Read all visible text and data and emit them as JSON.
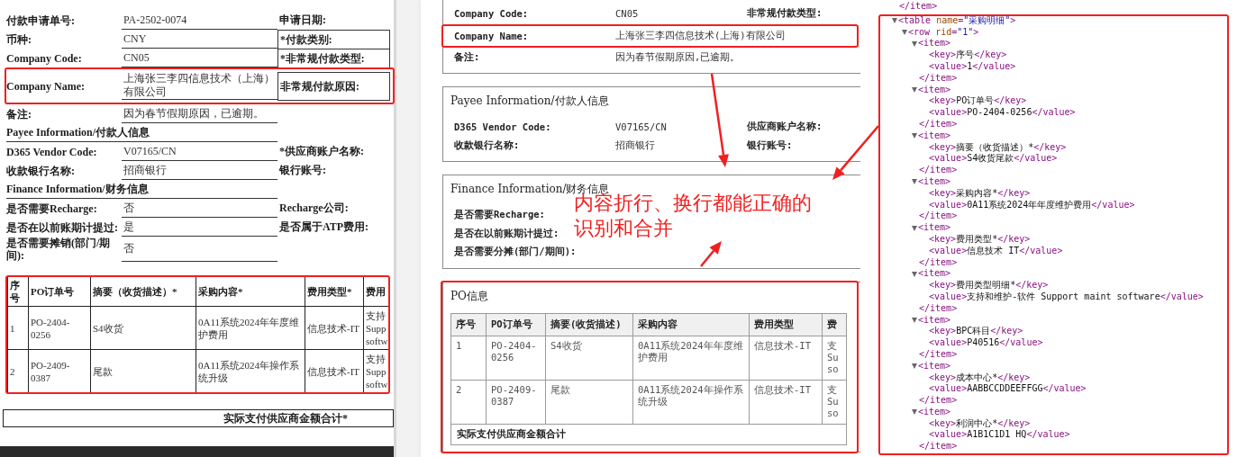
{
  "scan_form": {
    "rows": [
      {
        "kind": "field",
        "label": "付款申请单号:",
        "value": "PA-2502-0074",
        "side": "申请日期:",
        "side_boxed": false,
        "highlighted": false
      },
      {
        "kind": "field",
        "label": "币种:",
        "value": "CNY",
        "side": "*付款类别:",
        "side_boxed": true,
        "highlighted": false
      },
      {
        "kind": "field",
        "label": "Company Code:",
        "value": "CN05",
        "side": "*非常规付款类型:",
        "side_boxed": true,
        "highlighted": false
      },
      {
        "kind": "field",
        "label": "Company Name:",
        "value": "上海张三李四信息技术（上海）有限公司",
        "side": "非常规付款原因:",
        "side_boxed": true,
        "highlighted": true
      },
      {
        "kind": "field",
        "label": "备注:",
        "value": "因为春节假期原因，已逾期。",
        "highlighted": false
      },
      {
        "kind": "section",
        "label": "Payee Information/付款人信息",
        "highlighted": false
      },
      {
        "kind": "field",
        "label": "D365 Vendor Code:",
        "value": "V07165/CN",
        "side": "*供应商账户名称:",
        "side_boxed": false,
        "highlighted": false
      },
      {
        "kind": "field",
        "label": "收款银行名称:",
        "value": "招商银行",
        "side": "银行账号:",
        "side_boxed": false,
        "highlighted": false
      },
      {
        "kind": "section",
        "label": "Finance Information/财务信息",
        "highlighted": false
      },
      {
        "kind": "field",
        "label": "是否需要Recharge:",
        "value": "否",
        "side": "Recharge公司:",
        "side_boxed": false,
        "highlighted": false
      },
      {
        "kind": "field",
        "label": "是否在以前账期计提过:",
        "value": "是",
        "side": "是否属于ATP费用:",
        "side_boxed": false,
        "highlighted": false
      },
      {
        "kind": "field",
        "label": "是否需要摊销(部门/期间):",
        "value": "否",
        "highlighted": false
      }
    ],
    "table": {
      "highlighted": true,
      "columns": [
        "序号",
        "PO订单号",
        "摘要（收货描述）*",
        "采购内容*",
        "费用类型*",
        "费用"
      ],
      "rows": [
        [
          "1",
          "PO-2404-0256",
          "S4收货",
          "0A11系统2024年年度维护费用",
          "信息技术-IT",
          "支持\nSupp\nsoftw"
        ],
        [
          "2",
          "PO-2409-0387",
          "尾款",
          "0A11系统2024年操作系统升级",
          "信息技术-IT",
          "支持\nSupp\nsoftw"
        ]
      ]
    },
    "footer": "实际支付供应商金额合计*"
  },
  "rendered_form": {
    "cards": [
      {
        "highlighted": false,
        "rows": [
          {
            "label": "Company Code:",
            "value": "CN05",
            "side": "非常规付款类型:",
            "highlighted": false
          },
          {
            "label": "Company Name:",
            "value": "上海张三李四信息技术(上海)有限公司",
            "highlighted": true
          },
          {
            "label": "备注:",
            "value": "因为春节假期原因,已逾期。",
            "highlighted": false
          }
        ]
      },
      {
        "highlighted": false,
        "title": "Payee Information/付款人信息",
        "rows": [
          {
            "label": "D365 Vendor Code:",
            "value": "V07165/CN",
            "side": "供应商账户名称:",
            "highlighted": false
          },
          {
            "label": "收款银行名称:",
            "value": "招商银行",
            "side": "银行账号:",
            "highlighted": false
          }
        ]
      },
      {
        "highlighted": false,
        "title": "Finance Information/财务信息",
        "rows": [
          {
            "label": "是否需要Recharge:",
            "highlighted": false
          },
          {
            "label": "是否在以前账期计提过:",
            "highlighted": false
          },
          {
            "label": "是否需要分摊(部门/期间):",
            "highlighted": false
          }
        ]
      },
      {
        "highlighted": true,
        "title": "PO信息",
        "table": {
          "columns": [
            "序号",
            "PO订单号",
            "摘要(收货描述)",
            "采购内容",
            "费用类型",
            "费"
          ],
          "rows": [
            [
              "1",
              "PO-2404-0256",
              "S4收货",
              "0A11系统2024年年度维护费用",
              "信息技术-IT",
              "支\nSu\nso"
            ],
            [
              "2",
              "PO-2409-0387",
              "尾款",
              "0A11系统2024年操作系统升级",
              "信息技术-IT",
              "支\nSu\nso"
            ]
          ],
          "footer": "实际支付供应商金额合计"
        }
      }
    ]
  },
  "annotation": {
    "caption": "内容折行、换行都能正确的识别和合并"
  },
  "xml_view": {
    "lines_before": [
      "</item>"
    ],
    "tree": {
      "highlighted": true,
      "open": "<table name=\"采购明细\">",
      "expanded": true,
      "children": [
        {
          "open": "<row rid=\"1\">",
          "expanded": true,
          "children": [
            {
              "open": "<item>",
              "expanded": true,
              "lines": [
                "<key>序号</key>",
                "<value>1</value>"
              ],
              "close": "</item>"
            },
            {
              "open": "<item>",
              "expanded": true,
              "lines": [
                "<key>PO订单号</key>",
                "<value>PO-2404-0256</value>"
              ],
              "close": "</item>"
            },
            {
              "open": "<item>",
              "expanded": true,
              "lines": [
                "<key>摘要（收货描述）*</key>",
                "<value>S4收货尾款</value>"
              ],
              "close": "</item>"
            },
            {
              "open": "<item>",
              "expanded": true,
              "lines": [
                "<key>采购内容*</key>",
                "<value>0A11系统2024年年度维护费用</value>"
              ],
              "close": "</item>"
            },
            {
              "open": "<item>",
              "expanded": true,
              "lines": [
                "<key>费用类型*</key>",
                "<value>信息技术 IT</value>"
              ],
              "close": "</item>"
            },
            {
              "open": "<item>",
              "expanded": true,
              "lines": [
                "<key>费用类型明细*</key>",
                "<value>支持和维护-软件 Support maint software</value>"
              ],
              "close": "</item>"
            },
            {
              "open": "<item>",
              "expanded": true,
              "lines": [
                "<key>BPC科目</key>",
                "<value>P40516</value>"
              ],
              "close": "</item>"
            },
            {
              "open": "<item>",
              "expanded": true,
              "lines": [
                "<key>成本中心*</key>",
                "<value>AABBCCDDEEFFGG</value>"
              ],
              "close": "</item>"
            },
            {
              "open": "<item>",
              "expanded": true,
              "lines": [
                "<key>利润中心*</key>",
                "<value>A1B1C1D1 HQ</value>"
              ],
              "close": "</item>"
            }
          ]
        }
      ]
    }
  }
}
